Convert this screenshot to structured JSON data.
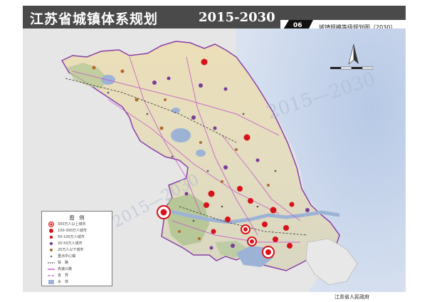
{
  "header": {
    "title": "江苏省城镇体系规划",
    "years": "2015-2030",
    "map_number": "06",
    "map_subtitle": "城镇规模等级规划图（2030）"
  },
  "legend": {
    "title": "图　例",
    "items": [
      {
        "label": "300万人以上城市",
        "symbol": "big-ring"
      },
      {
        "label": "100-300万人城市",
        "symbol": "red-dot"
      },
      {
        "label": "50-100万人城市",
        "symbol": "red-dot-small"
      },
      {
        "label": "20-50万人城市",
        "symbol": "purple-dot"
      },
      {
        "label": "20万人以下城市",
        "symbol": "brown-dot"
      },
      {
        "label": "重点中心镇",
        "symbol": "small-dot"
      },
      {
        "label": "铁　路",
        "symbol": "rail"
      },
      {
        "label": "高速公路",
        "symbol": "road"
      },
      {
        "label": "省　界",
        "symbol": "border"
      },
      {
        "label": "水　体",
        "symbol": "water"
      }
    ]
  },
  "footer": {
    "publisher": "江苏省人民政府"
  },
  "watermark": {
    "text": "2015—2030"
  },
  "colors": {
    "title_bar": "#4a4a4a",
    "sea": "#c9d7ec",
    "province_land": "#e9e4c9",
    "outside_land": "#e4e4e4",
    "water": "#9db3d6",
    "city_large": "#d8121a",
    "city_medium": "#8a3fa8",
    "city_small": "#b06b2a"
  },
  "map_features": {
    "north_arrow": "north-arrow-icon",
    "scale_bar": "scale-bar-icon"
  }
}
